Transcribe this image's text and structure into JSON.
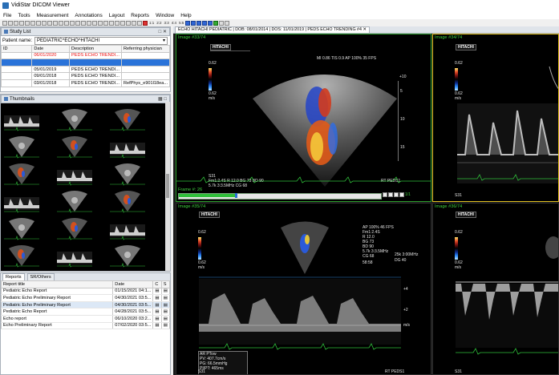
{
  "window": {
    "title": "VidiStar DICOM Viewer"
  },
  "menu": [
    "File",
    "Tools",
    "Measurement",
    "Annotations",
    "Layout",
    "Reports",
    "Window",
    "Help"
  ],
  "toolbar": {
    "labels": [
      "1:1",
      "2:2",
      "3:3",
      "4:4",
      "5:5"
    ]
  },
  "study_list": {
    "title": "Study List",
    "patient_label": "Patient name:",
    "patient_value": "PEDIATRIC^ECHO^HITACHI",
    "columns": [
      "ID",
      "Date",
      "Description",
      "Referring physician"
    ],
    "rows": [
      {
        "id": "",
        "date": "06/01/2020",
        "desc": "PEDS ECHO TRENDI...",
        "ref": ""
      },
      {
        "id": "",
        "date": "",
        "desc": "",
        "ref": ""
      },
      {
        "id": "",
        "date": "05/01/2019",
        "desc": "PEDS ECHO TRENDI...",
        "ref": ""
      },
      {
        "id": "",
        "date": "09/01/2018",
        "desc": "PEDS ECHO TRENDI...",
        "ref": ""
      },
      {
        "id": "",
        "date": "03/01/2018",
        "desc": "PEDS ECHO TRENDI...",
        "ref": "RefPhys_e901l18ea..."
      }
    ]
  },
  "thumbnails": {
    "title": "Thumbnails"
  },
  "reports": {
    "tabs": [
      "Reports",
      "SR/Others"
    ],
    "columns": [
      "Report title",
      "Date",
      "C",
      "S"
    ],
    "rows": [
      {
        "title": "Pediatric Echo Report",
        "date": "01/15/2021 04:1...",
        "c": "",
        "s": ""
      },
      {
        "title": "Pediatric Echo Preliminary Report",
        "date": "04/30/2021 03:5...",
        "c": "",
        "s": ""
      },
      {
        "title": "Pediatric Echo Preliminary Report",
        "date": "04/30/2021 03:5...",
        "c": "",
        "s": ""
      },
      {
        "title": "Pediatric Echo Report",
        "date": "04/28/2021 03:5...",
        "c": "",
        "s": ""
      },
      {
        "title": "Echo report",
        "date": "06/10/2020 03:2...",
        "c": "",
        "s": ""
      },
      {
        "title": "Echo Preliminary Report",
        "date": "07/02/2020 03:5...",
        "c": "",
        "s": ""
      }
    ]
  },
  "viewer": {
    "tab_title": "ECHO HITACHI PEDIATRIC | DOB: 08/01/2014 | DOS: 11/01/2019 | PEDS ECHO TRENDING #4",
    "vp1": {
      "label": "Image #33/74",
      "brand": "HITACHI",
      "scale_top": "0.62",
      "scale_bottom": "0.62",
      "unit": "m/s",
      "header_info": "MI 0.86  TIS 0.9     AP 100%      35 FPS",
      "depth_top": "+10",
      "params": [
        "S31",
        "Fm1:2.4S     R 12.0  BG 73  BD 90",
        "5.7k  3:3.5MHz      CG 68"
      ],
      "frame": "Frame #:  26",
      "preset": "RT PEDS1",
      "ruler": [
        "5",
        "10",
        "15"
      ],
      "play_label": "1/1"
    },
    "vp2": {
      "label": "Image #34/74",
      "brand": "HITACHI",
      "scale_top": "0.62",
      "scale_bottom": "0.62",
      "unit": "m/s",
      "probe": "S31"
    },
    "vp3": {
      "label": "Image #35/74",
      "brand": "HITACHI",
      "scale_top": "0.62",
      "scale_bottom": "0.62",
      "unit": "m/s",
      "header_info": "AP 100%      46 FPS",
      "params": [
        "Fm1:2.4S",
        "R 12.0",
        "BG 73",
        "BD 90",
        "5.7k 3:3.5MHz",
        "CG 68",
        "58:58"
      ],
      "params2": [
        "25k 3:00MHz",
        "DG 40"
      ],
      "axis": [
        "+4",
        "+2",
        "m/s"
      ],
      "meas": [
        "AR PTow",
        "PV:  407.7cm/s",
        "PG:   66.5mmHg",
        "PI/PT:  465ms"
      ],
      "probe": "S31",
      "preset": "RT PEDS1"
    },
    "vp4": {
      "label": "Image #36/74",
      "brand": "HITACHI",
      "scale_top": "0.62",
      "scale_bottom": "0.62",
      "unit": "m/s",
      "probe": "S31"
    }
  }
}
